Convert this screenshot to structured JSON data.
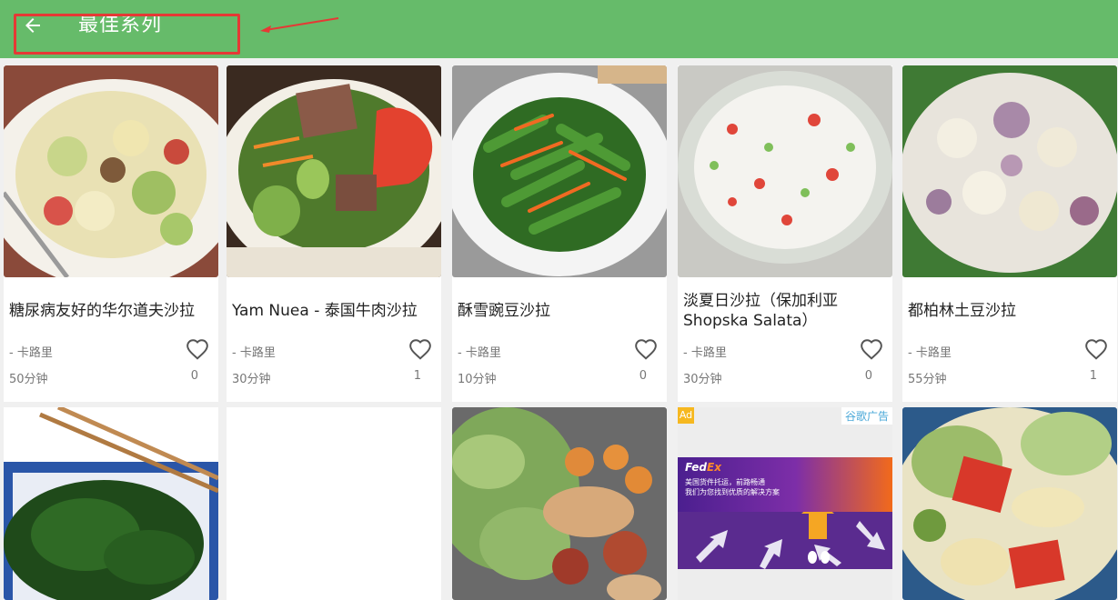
{
  "header": {
    "title": "最佳系列",
    "back_icon": "arrow-left-icon",
    "color": "#66bb6a"
  },
  "recipes": [
    {
      "name": "糖尿病友好的华尔道夫沙拉",
      "calories": "- 卡路里",
      "time": "50分钟",
      "likes": "0"
    },
    {
      "name": "Yam Nuea - 泰国牛肉沙拉",
      "calories": "- 卡路里",
      "time": "30分钟",
      "likes": "1"
    },
    {
      "name": "酥雪豌豆沙拉",
      "calories": "- 卡路里",
      "time": "10分钟",
      "likes": "0"
    },
    {
      "name": "淡夏日沙拉（保加利亚 Shopska Salata）",
      "calories": "- 卡路里",
      "time": "30分钟",
      "likes": "0"
    },
    {
      "name": "都柏林土豆沙拉",
      "calories": "- 卡路里",
      "time": "55分钟",
      "likes": "1"
    }
  ],
  "ad": {
    "badge": "Ad",
    "provider": "谷歌广告",
    "brand_fed": "Fed",
    "brand_ex": "Ex",
    "line1": "美国货件托运，前路畅通",
    "line2": "我们为您找到优质的解决方案"
  }
}
